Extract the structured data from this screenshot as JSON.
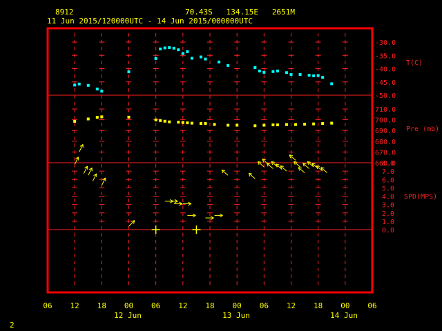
{
  "header": {
    "station_id": "8912",
    "location": "70.43S   134.15E   2651M",
    "time_range": "11 Jun 2015/120000UTC - 14 Jun 2015/000000UTC"
  },
  "footer": {
    "page_number": "2"
  },
  "axes": {
    "temp_label": "T(C)",
    "pres_label": "Pre (mb)",
    "spd_label": "SPD(MPS)",
    "temp_ticks": [
      "-30.0",
      "-35.0",
      "-40.0",
      "-45.0",
      "-50.0"
    ],
    "pres_ticks": [
      "710.0",
      "700.0",
      "690.0",
      "680.0",
      "670.0",
      "660.0"
    ],
    "spd_ticks": [
      "8.0",
      "7.0",
      "6.0",
      "5.0",
      "4.0",
      "3.0",
      "2.0",
      "1.0",
      "0.0"
    ],
    "x_tick_labels": [
      "06",
      "12",
      "18",
      "00",
      "06",
      "12",
      "18",
      "00",
      "06",
      "12",
      "18",
      "00",
      "06"
    ],
    "date_labels": [
      "12 Jun",
      "13 Jun",
      "14 Jun"
    ]
  },
  "colors": {
    "frame": "#ff0000",
    "grid": "#ff2020",
    "temperature": "#00ffff",
    "pressure": "#ffff00",
    "wind": "#ffff00"
  },
  "chart_data": {
    "type": "scatter",
    "x_unit": "hours UTC",
    "x_range": [
      "2015-06-11 06:00",
      "2015-06-14 06:00"
    ],
    "temperature": {
      "ylim": [
        -52,
        -27
      ],
      "points": [
        [
          "2015-06-11 12:00",
          -46.2
        ],
        [
          "2015-06-11 13:00",
          -45.8
        ],
        [
          "2015-06-11 15:00",
          -46.3
        ],
        [
          "2015-06-11 17:00",
          -47.7
        ],
        [
          "2015-06-11 18:00",
          -48.5
        ],
        [
          "2015-06-12 00:00",
          -41.2
        ],
        [
          "2015-06-12 06:00",
          -36.2
        ],
        [
          "2015-06-12 07:00",
          -32.6
        ],
        [
          "2015-06-12 08:00",
          -32.2
        ],
        [
          "2015-06-12 09:00",
          -32.1
        ],
        [
          "2015-06-12 10:00",
          -32.3
        ],
        [
          "2015-06-12 11:00",
          -32.9
        ],
        [
          "2015-06-12 12:00",
          -34.3
        ],
        [
          "2015-06-12 13:00",
          -33.6
        ],
        [
          "2015-06-12 14:00",
          -36.1
        ],
        [
          "2015-06-12 16:00",
          -35.6
        ],
        [
          "2015-06-12 17:00",
          -36.4
        ],
        [
          "2015-06-12 20:00",
          -37.5
        ],
        [
          "2015-06-12 22:00",
          -38.8
        ],
        [
          "2015-06-13 04:00",
          -39.6
        ],
        [
          "2015-06-13 05:00",
          -40.9
        ],
        [
          "2015-06-13 06:00",
          -41.4
        ],
        [
          "2015-06-13 08:00",
          -41.1
        ],
        [
          "2015-06-13 09:00",
          -40.9
        ],
        [
          "2015-06-13 11:00",
          -41.5
        ],
        [
          "2015-06-13 12:00",
          -42.2
        ],
        [
          "2015-06-13 14:00",
          -42.2
        ],
        [
          "2015-06-13 16:00",
          -42.5
        ],
        [
          "2015-06-13 17:00",
          -42.7
        ],
        [
          "2015-06-13 18:00",
          -42.6
        ],
        [
          "2015-06-13 19:00",
          -43.3
        ],
        [
          "2015-06-13 21:00",
          -45.7
        ]
      ]
    },
    "pressure": {
      "ylim": [
        657,
        720
      ],
      "points": [
        [
          "2015-06-11 12:00",
          698.5
        ],
        [
          "2015-06-11 15:00",
          700.7
        ],
        [
          "2015-06-11 17:00",
          702.2
        ],
        [
          "2015-06-11 18:00",
          702.7
        ],
        [
          "2015-06-12 00:00",
          702.4
        ],
        [
          "2015-06-12 06:00",
          699.8
        ],
        [
          "2015-06-12 07:00",
          699.2
        ],
        [
          "2015-06-12 08:00",
          698.6
        ],
        [
          "2015-06-12 09:00",
          698.0
        ],
        [
          "2015-06-12 11:00",
          697.7
        ],
        [
          "2015-06-12 12:00",
          697.4
        ],
        [
          "2015-06-12 13:00",
          697.1
        ],
        [
          "2015-06-12 14:00",
          696.8
        ],
        [
          "2015-06-12 16:00",
          696.5
        ],
        [
          "2015-06-12 17:00",
          696.5
        ],
        [
          "2015-06-12 19:00",
          695.6
        ],
        [
          "2015-06-12 22:00",
          694.9
        ],
        [
          "2015-06-13 00:00",
          694.9
        ],
        [
          "2015-06-13 04:00",
          694.4
        ],
        [
          "2015-06-13 06:00",
          694.9
        ],
        [
          "2015-06-13 08:00",
          695.2
        ],
        [
          "2015-06-13 09:00",
          695.2
        ],
        [
          "2015-06-13 11:00",
          695.5
        ],
        [
          "2015-06-13 13:00",
          695.5
        ],
        [
          "2015-06-13 15:00",
          695.8
        ],
        [
          "2015-06-13 17:00",
          696.1
        ],
        [
          "2015-06-13 19:00",
          696.5
        ],
        [
          "2015-06-13 21:00",
          696.8
        ]
      ]
    },
    "wind": {
      "ylim": [
        0,
        9
      ],
      "note": "arrows show wind direction; calm marked with a cross",
      "points": [
        {
          "t": "2015-06-11 12:00",
          "spd": 7.8,
          "dx": 0.45,
          "dy": -0.9
        },
        {
          "t": "2015-06-11 13:00",
          "spd": 9.3,
          "dx": 0.45,
          "dy": -0.9
        },
        {
          "t": "2015-06-11 14:00",
          "spd": 6.7,
          "dx": 0.45,
          "dy": -0.9
        },
        {
          "t": "2015-06-11 15:00",
          "spd": 6.5,
          "dx": 0.45,
          "dy": -0.9
        },
        {
          "t": "2015-06-11 16:00",
          "spd": 5.8,
          "dx": 0.45,
          "dy": -0.9
        },
        {
          "t": "2015-06-11 18:00",
          "spd": 5.3,
          "dx": 0.45,
          "dy": -0.9
        },
        {
          "t": "2015-06-12 00:00",
          "spd": 0.4,
          "dx": 0.7,
          "dy": -0.7
        },
        {
          "t": "2015-06-12 06:00",
          "spd": 0.0,
          "calm": true
        },
        {
          "t": "2015-06-12 08:00",
          "spd": 3.4,
          "dx": 1,
          "dy": 0
        },
        {
          "t": "2015-06-12 09:00",
          "spd": 3.4,
          "dx": 1,
          "dy": 0
        },
        {
          "t": "2015-06-12 10:00",
          "spd": 3.1,
          "dx": 1,
          "dy": 0
        },
        {
          "t": "2015-06-12 12:00",
          "spd": 3.1,
          "dx": 1,
          "dy": 0
        },
        {
          "t": "2015-06-12 13:00",
          "spd": 1.7,
          "dx": 1,
          "dy": 0
        },
        {
          "t": "2015-06-12 15:00",
          "spd": 0.0,
          "calm": true
        },
        {
          "t": "2015-06-12 17:00",
          "spd": 1.4,
          "dx": 1,
          "dy": 0
        },
        {
          "t": "2015-06-12 19:00",
          "spd": 1.7,
          "dx": 1,
          "dy": 0
        },
        {
          "t": "2015-06-12 22:00",
          "spd": 6.5,
          "dx": -0.75,
          "dy": -0.65
        },
        {
          "t": "2015-06-13 04:00",
          "spd": 6.1,
          "dx": -0.75,
          "dy": -0.65
        },
        {
          "t": "2015-06-13 06:00",
          "spd": 7.5,
          "dx": -0.75,
          "dy": -0.65
        },
        {
          "t": "2015-06-13 07:00",
          "spd": 7.8,
          "dx": -0.75,
          "dy": -0.65
        },
        {
          "t": "2015-06-13 08:00",
          "spd": 7.3,
          "dx": -0.75,
          "dy": -0.65
        },
        {
          "t": "2015-06-13 09:00",
          "spd": 7.5,
          "dx": -0.75,
          "dy": -0.65
        },
        {
          "t": "2015-06-13 10:00",
          "spd": 7.2,
          "dx": -0.75,
          "dy": -0.65
        },
        {
          "t": "2015-06-13 11:00",
          "spd": 7.0,
          "dx": -0.75,
          "dy": -0.65
        },
        {
          "t": "2015-06-13 13:00",
          "spd": 8.3,
          "dx": -0.75,
          "dy": -0.65
        },
        {
          "t": "2015-06-13 14:00",
          "spd": 7.5,
          "dx": -0.75,
          "dy": -0.65
        },
        {
          "t": "2015-06-13 15:00",
          "spd": 6.8,
          "dx": -0.75,
          "dy": -0.65
        },
        {
          "t": "2015-06-13 16:00",
          "spd": 7.3,
          "dx": -0.75,
          "dy": -0.65
        },
        {
          "t": "2015-06-13 17:00",
          "spd": 7.5,
          "dx": -0.75,
          "dy": -0.65
        },
        {
          "t": "2015-06-13 18:00",
          "spd": 7.3,
          "dx": -0.75,
          "dy": -0.65
        },
        {
          "t": "2015-06-13 19:00",
          "spd": 7.0,
          "dx": -0.75,
          "dy": -0.65
        },
        {
          "t": "2015-06-13 20:00",
          "spd": 6.8,
          "dx": -0.75,
          "dy": -0.65
        }
      ]
    }
  }
}
